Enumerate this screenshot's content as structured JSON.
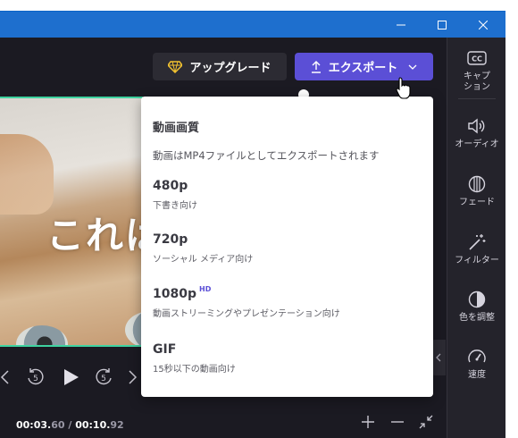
{
  "window": {
    "controls": [
      "minimize",
      "maximize",
      "close"
    ]
  },
  "header": {
    "upgrade_label": "アップグレード",
    "export_label": "エクスポート"
  },
  "preview": {
    "caption": "これは"
  },
  "playback": {
    "current_main": "00:03.",
    "current_frac": "60",
    "separator": " / ",
    "total_main": "00:10.",
    "total_frac": "92",
    "skip_back_label": "5",
    "skip_forward_label": "5"
  },
  "export_menu": {
    "title": "動画画質",
    "subtitle": "動画はMP4ファイルとしてエクスポートされます",
    "options": [
      {
        "label": "480p",
        "badge": "",
        "desc": "下書き向け"
      },
      {
        "label": "720p",
        "badge": "",
        "desc": "ソーシャル メディア向け"
      },
      {
        "label": "1080p",
        "badge": "HD",
        "desc": "動画ストリーミングやプレゼンテーション向け"
      },
      {
        "label": "GIF",
        "badge": "",
        "desc": "15秒以下の動画向け"
      }
    ]
  },
  "sidebar": {
    "items": [
      {
        "icon": "captions-icon",
        "label": "キャプション"
      },
      {
        "icon": "audio-icon",
        "label": "オーディオ"
      },
      {
        "icon": "fade-icon",
        "label": "フェード"
      },
      {
        "icon": "filter-icon",
        "label": "フィルター"
      },
      {
        "icon": "color-adjust-icon",
        "label": "色を調整"
      },
      {
        "icon": "speed-icon",
        "label": "速度"
      }
    ]
  },
  "colors": {
    "accent": "#5b4fd6",
    "titlebar": "#1e6fce",
    "background": "#1b1a22",
    "timeline_highlight": "#3fd3a0"
  }
}
